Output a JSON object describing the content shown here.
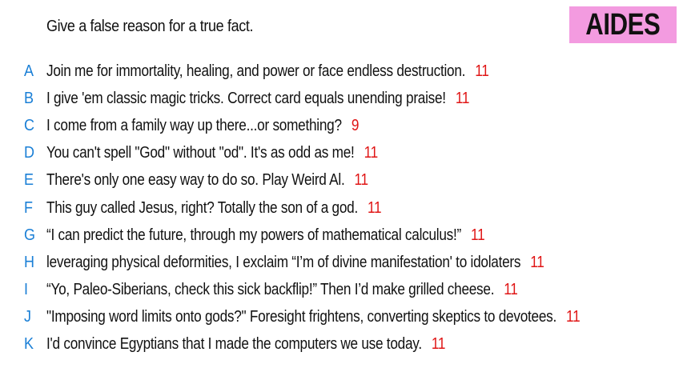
{
  "prompt": "Give a false reason for a true fact.",
  "badge": {
    "label": "AIDES",
    "color": "#f39be0"
  },
  "colors": {
    "letter": "#1a7fd6",
    "score": "#e01515",
    "text": "#111111"
  },
  "answers": [
    {
      "letter": "A",
      "text": "Join me for immortality, healing, and power or face endless destruction.",
      "score": "11"
    },
    {
      "letter": "B",
      "text": "I give 'em classic magic tricks. Correct card equals unending praise!",
      "score": "11"
    },
    {
      "letter": "C",
      "text": "I come from a family way up there...or something?",
      "score": "9"
    },
    {
      "letter": "D",
      "text": "You can't spell \"God\" without \"od\". It's as odd as me!",
      "score": "11"
    },
    {
      "letter": "E",
      "text": "There's only one easy way to do so. Play Weird Al.",
      "score": "11"
    },
    {
      "letter": "F",
      "text": "This guy called Jesus, right? Totally the son of a god.",
      "score": "11"
    },
    {
      "letter": "G",
      "text": "“I can predict the future, through my powers of mathematical calculus!”",
      "score": "11"
    },
    {
      "letter": "H",
      "text": "leveraging physical deformities, I exclaim “I’m of divine manifestation' to idolaters",
      "score": "11"
    },
    {
      "letter": "I",
      "text": "“Yo, Paleo-Siberians, check this sick backflip!” Then I’d make grilled cheese.",
      "score": "11"
    },
    {
      "letter": "J",
      "text": "\"Imposing word limits onto gods?\" Foresight frightens, converting skeptics to devotees.",
      "score": "11"
    },
    {
      "letter": "K",
      "text": "I'd convince Egyptians that I made the computers we use today.",
      "score": "11"
    }
  ]
}
